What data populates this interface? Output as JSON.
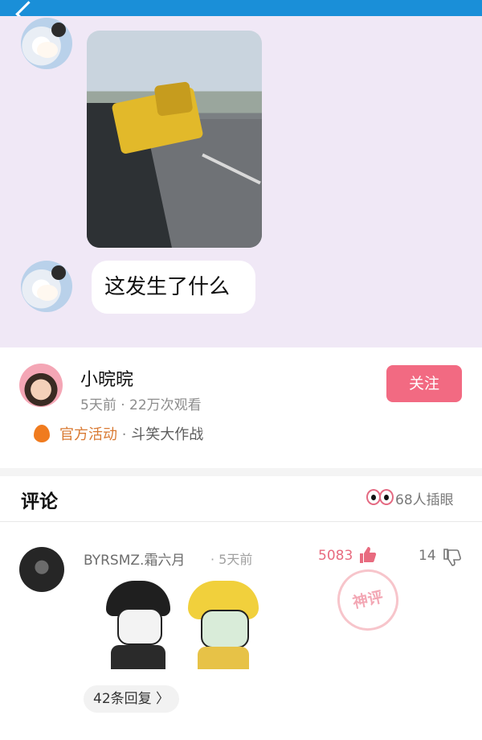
{
  "top_bar": {
    "title": ""
  },
  "chat": {
    "bubble_text": "这发生了什么"
  },
  "post": {
    "username": "小晥晥",
    "meta": "5天前 · 22万次观看",
    "follow_label": "关注",
    "activity_tag": "官方活动",
    "activity_separator": "·",
    "activity_name": "斗笑大作战"
  },
  "comments_header": {
    "title": "评论",
    "peek_count": "68人插眼"
  },
  "comment": {
    "username": "BYRSMZ.霜六月",
    "time": "· 5天前",
    "likes": "5083",
    "dislikes": "14",
    "stamp": "神评",
    "replies_label": "42条回复 〉"
  },
  "colors": {
    "accent": "#f26a82",
    "top_bar": "#1a8fd8",
    "chat_background": "#f0e8f6",
    "activity_tag": "#d97a33"
  },
  "icons": {
    "back": "back-chevron-icon",
    "fire": "fire-icon",
    "eyes": "eyes-icon",
    "thumb_up": "thumb-up-icon",
    "thumb_down": "thumb-down-icon"
  }
}
